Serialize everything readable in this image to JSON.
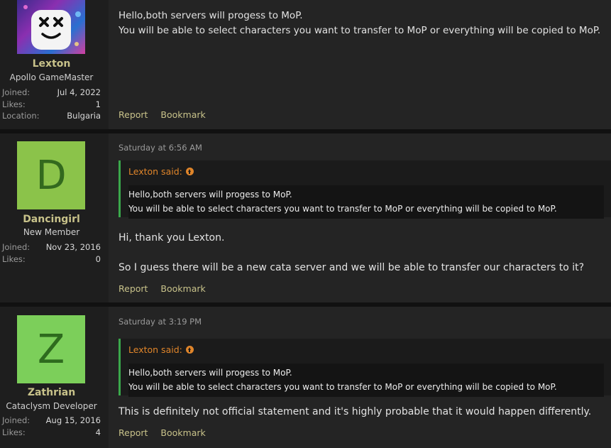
{
  "posts": [
    {
      "username": "Lexton",
      "user_title": "Apollo GameMaster",
      "stats": [
        {
          "label": "Joined:",
          "value": "Jul 4, 2022"
        },
        {
          "label": "Likes:",
          "value": "1"
        },
        {
          "label": "Location:",
          "value": "Bulgaria"
        }
      ],
      "lines": [
        "Hello,both servers will progess to MoP.",
        "You will be able to select characters you want to transfer to MoP or everything will be copied to MoP."
      ],
      "actions": [
        "Report",
        "Bookmark"
      ]
    },
    {
      "username": "Dancingirl",
      "user_title": "New Member",
      "avatar_letter": "D",
      "avatar_color": "#8bc34a",
      "stats": [
        {
          "label": "Joined:",
          "value": "Nov 23, 2016"
        },
        {
          "label": "Likes:",
          "value": "0"
        }
      ],
      "date": "Saturday at 6:56 AM",
      "quote": {
        "author": "Lexton said:",
        "lines": [
          "Hello,both servers will progess to MoP.",
          "You will be able to select characters you want to transfer to MoP or everything will be copied to MoP."
        ]
      },
      "lines": [
        "Hi, thank you Lexton.",
        "So I guess there will be a new cata server and we will be able to transfer our characters to it?"
      ],
      "actions": [
        "Report",
        "Bookmark"
      ]
    },
    {
      "username": "Zathrian",
      "user_title": "Cataclysm Developer",
      "avatar_letter": "Z",
      "avatar_color": "#7ccf5a",
      "stats": [
        {
          "label": "Joined:",
          "value": "Aug 15, 2016"
        },
        {
          "label": "Likes:",
          "value": "4"
        }
      ],
      "date": "Saturday at 3:19 PM",
      "quote": {
        "author": "Lexton said:",
        "lines": [
          "Hello,both servers will progess to MoP.",
          "You will be able to select characters you want to transfer to MoP or everything will be copied to MoP."
        ]
      },
      "lines": [
        "This is definitely not official statement and it's highly probable that it would happen differently."
      ],
      "actions": [
        "Report",
        "Bookmark"
      ]
    }
  ]
}
